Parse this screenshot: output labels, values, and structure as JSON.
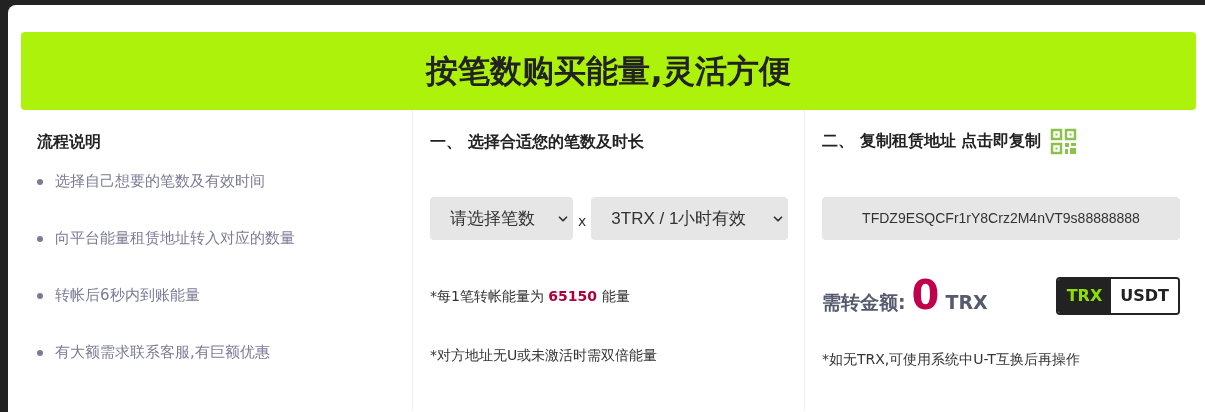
{
  "banner": {
    "title": "按笔数购买能量,灵活方便"
  },
  "process": {
    "title": "流程说明",
    "steps": [
      "选择自己想要的笔数及有效时间",
      "向平台能量租赁地址转入对应的数量",
      "转帐后6秒内到账能量",
      "有大额需求联系客服,有巨额优惠"
    ]
  },
  "step_one": {
    "title": "一、 选择合适您的笔数及时长",
    "count_select": "请选择笔数",
    "times_sign": "x",
    "duration_select": "3TRX / 1小时有效",
    "notes": [
      "*每1笔转帐能量为 **65150** 能量",
      "*对方地址无U或未激活时需双倍能量"
    ]
  },
  "step_two": {
    "title": "二、 复制租赁地址 点击即复制",
    "address": "TFDZ9ESQCFr1rY8Crz2M4nVT9s88888888",
    "amount_label": "需转金额:",
    "amount": "0",
    "amount_unit": "TRX",
    "currencies": [
      {
        "label": "TRX",
        "selected": true
      },
      {
        "label": "USDT",
        "selected": false
      }
    ],
    "note": "*如无TRX,可使用系统中U-T互换后再操作"
  }
}
